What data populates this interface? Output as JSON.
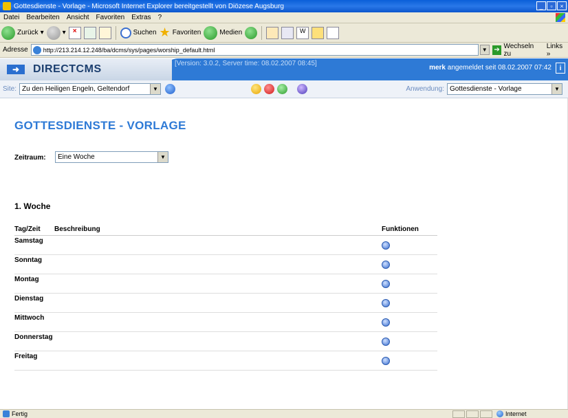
{
  "window": {
    "title": "Gottesdienste - Vorlage - Microsoft Internet Explorer bereitgestellt von Diözese Augsburg",
    "min": "_",
    "max": "▫",
    "close": "×"
  },
  "menu": {
    "items": [
      "Datei",
      "Bearbeiten",
      "Ansicht",
      "Favoriten",
      "Extras",
      "?"
    ]
  },
  "toolbar": {
    "back": "Zurück",
    "search": "Suchen",
    "favorites": "Favoriten",
    "media": "Medien"
  },
  "address": {
    "label": "Adresse",
    "url": "http://213.214.12.248/ba/dcms/sys/pages/worship_default.html",
    "go": "Wechseln zu",
    "links": "Links",
    "links_more": "»"
  },
  "cms": {
    "logo": "DIRECTCMS",
    "version": "[Version: 3.0.2, Server time: 08.02.2007 08:45]",
    "user": "merk",
    "login_info": "angemeldet seit 08.02.2007 07:42",
    "info_icon": "i"
  },
  "sitebar": {
    "site_label": "Site:",
    "site_value": "Zu den Heiligen Engeln, Geltendorf",
    "app_label": "Anwendung:",
    "app_value": "Gottesdienste - Vorlage"
  },
  "page": {
    "title": "GOTTESDIENSTE - VORLAGE",
    "zeitraum_label": "Zeitraum:",
    "zeitraum_value": "Eine Woche",
    "week_title": "1. Woche",
    "table": {
      "headers": [
        "Tag/Zeit",
        "Beschreibung",
        "Funktionen"
      ],
      "rows": [
        {
          "day": "Samstag"
        },
        {
          "day": "Sonntag"
        },
        {
          "day": "Montag"
        },
        {
          "day": "Dienstag"
        },
        {
          "day": "Mittwoch"
        },
        {
          "day": "Donnerstag"
        },
        {
          "day": "Freitag"
        }
      ]
    }
  },
  "status": {
    "text": "Fertig",
    "zone": "Internet"
  }
}
